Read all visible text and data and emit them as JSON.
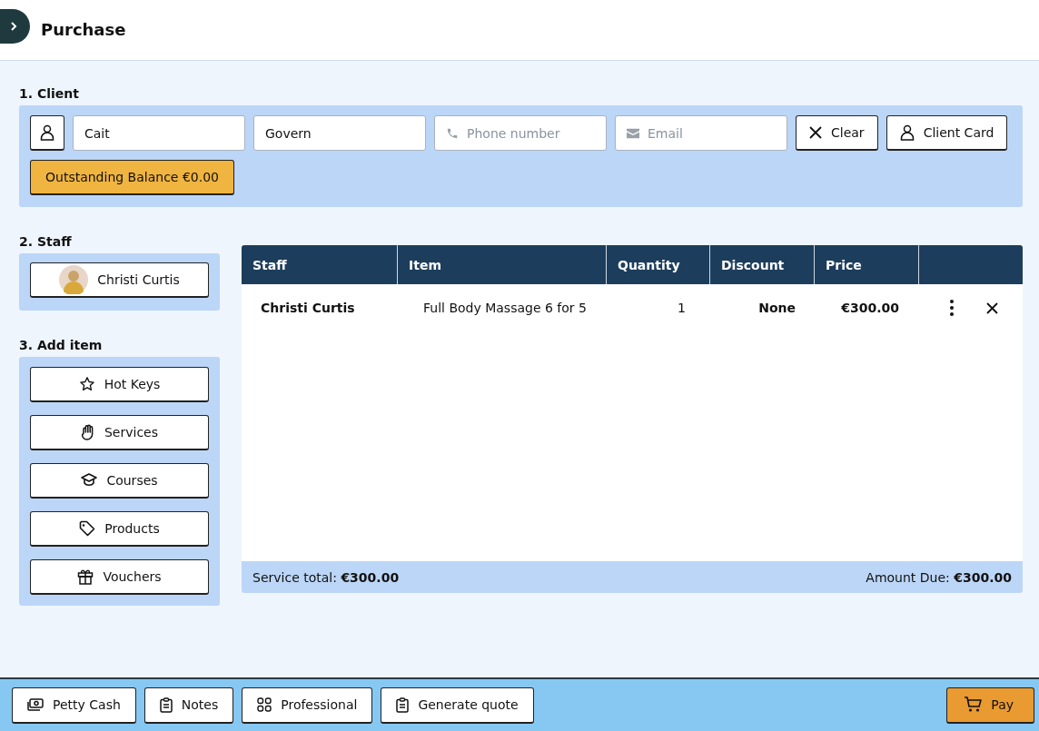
{
  "header": {
    "title": "Purchase"
  },
  "client": {
    "heading": "1. Client",
    "first_name": "Cait",
    "last_name": "Govern",
    "phone": {
      "placeholder": "Phone number"
    },
    "email": {
      "placeholder": "Email"
    },
    "clear_button": "Clear",
    "client_card_button": "Client Card",
    "balance_button": "Outstanding Balance €0.00"
  },
  "staff": {
    "heading": "2. Staff",
    "selected_staff": "Christi Curtis"
  },
  "add_item": {
    "heading": "3. Add item",
    "buttons": [
      {
        "label": "Hot Keys",
        "kind": "star"
      },
      {
        "label": "Services",
        "kind": "hand"
      },
      {
        "label": "Courses",
        "kind": "cap"
      },
      {
        "label": "Products",
        "kind": "tag"
      },
      {
        "label": "Vouchers",
        "kind": "gift"
      }
    ]
  },
  "table": {
    "columns": [
      "Staff",
      "Item",
      "Quantity",
      "Discount",
      "Price"
    ],
    "rows": [
      {
        "staff": "Christi Curtis",
        "item": "Full Body Massage 6 for 5",
        "quantity": "1",
        "discount": "None",
        "price": "€300.00"
      }
    ],
    "service_total": "Service total: **€300.00**",
    "amount_due": "Amount Due: **€300.00**"
  },
  "footer": {
    "buttons": [
      {
        "label": "Petty Cash",
        "kind": "cash"
      },
      {
        "label": "Notes",
        "kind": "clipboard"
      },
      {
        "label": "Professional",
        "kind": "grid"
      },
      {
        "label": "Generate quote",
        "kind": "clipboard"
      }
    ],
    "pay_button": "Pay"
  }
}
